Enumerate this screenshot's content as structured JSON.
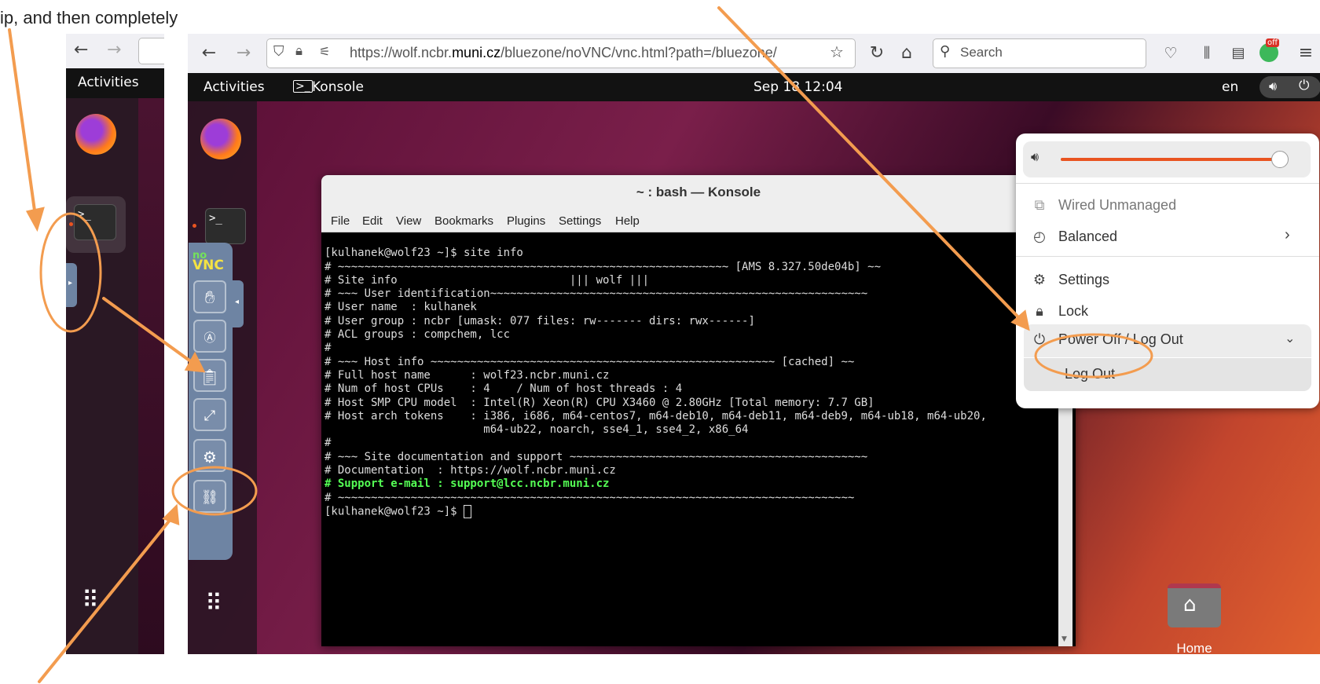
{
  "caption": "ip, and then completely",
  "browser": {
    "url_host_prefix": "https://wolf.ncbr.",
    "url_host_main": "muni.cz",
    "url_path": "/bluezone/noVNC/vnc.html?path=/bluezone/",
    "search_placeholder": "Search",
    "ext_badge": "off"
  },
  "topbar": {
    "activities": "Activities",
    "app_name": "Konsole",
    "clock": "Sep 18 12:04",
    "lang": "en"
  },
  "novnc_logo": {
    "top": "no",
    "bottom": "VNC"
  },
  "konsole": {
    "title": "~ : bash — Konsole",
    "menu": [
      "File",
      "Edit",
      "View",
      "Bookmarks",
      "Plugins",
      "Settings",
      "Help"
    ],
    "lines": [
      "[kulhanek@wolf23 ~]$ site info",
      "",
      "# ~~~~~~~~~~~~~~~~~~~~~~~~~~~~~~~~~~~~~~~~~~~~~~~~~~~~~~~~~~~ [AMS 8.327.50de04b] ~~",
      "# Site info                          ||| wolf |||",
      "# ~~~ User identification~~~~~~~~~~~~~~~~~~~~~~~~~~~~~~~~~~~~~~~~~~~~~~~~~~~~~~~~~",
      "# User name  : kulhanek",
      "# User group : ncbr [umask: 077 files: rw------- dirs: rwx------]",
      "# ACL groups : compchem, lcc",
      "#",
      "# ~~~ Host info ~~~~~~~~~~~~~~~~~~~~~~~~~~~~~~~~~~~~~~~~~~~~~~~~~~~~ [cached] ~~",
      "# Full host name      : wolf23.ncbr.muni.cz",
      "# Num of host CPUs    : 4    / Num of host threads : 4",
      "# Host SMP CPU model  : Intel(R) Xeon(R) CPU X3460 @ 2.80GHz [Total memory: 7.7 GB]",
      "# Host arch tokens    : i386, i686, m64-centos7, m64-deb10, m64-deb11, m64-deb9, m64-ub18, m64-ub20,",
      "                        m64-ub22, noarch, sse4_1, sse4_2, x86_64",
      "#",
      "# ~~~ Site documentation and support ~~~~~~~~~~~~~~~~~~~~~~~~~~~~~~~~~~~~~~~~~~~~~",
      "# Documentation  : https://wolf.ncbr.muni.cz",
      "# Support e-mail : support@lcc.ncbr.muni.cz",
      "# ~~~~~~~~~~~~~~~~~~~~~~~~~~~~~~~~~~~~~~~~~~~~~~~~~~~~~~~~~~~~~~~~~~~~~~~~~~~~~~",
      "",
      "[kulhanek@wolf23 ~]$ "
    ]
  },
  "system_menu": {
    "volume_fraction": 0.98,
    "wired": "Wired Unmanaged",
    "power_mode": "Balanced",
    "settings": "Settings",
    "lock": "Lock",
    "power_off": "Power Off / Log Out",
    "log_out": "Log Out"
  },
  "desktop": {
    "home_label": "Home"
  },
  "colors": {
    "annotation": "#f39c4f",
    "accent": "#e95420",
    "terminal_green": "#55ff55"
  }
}
